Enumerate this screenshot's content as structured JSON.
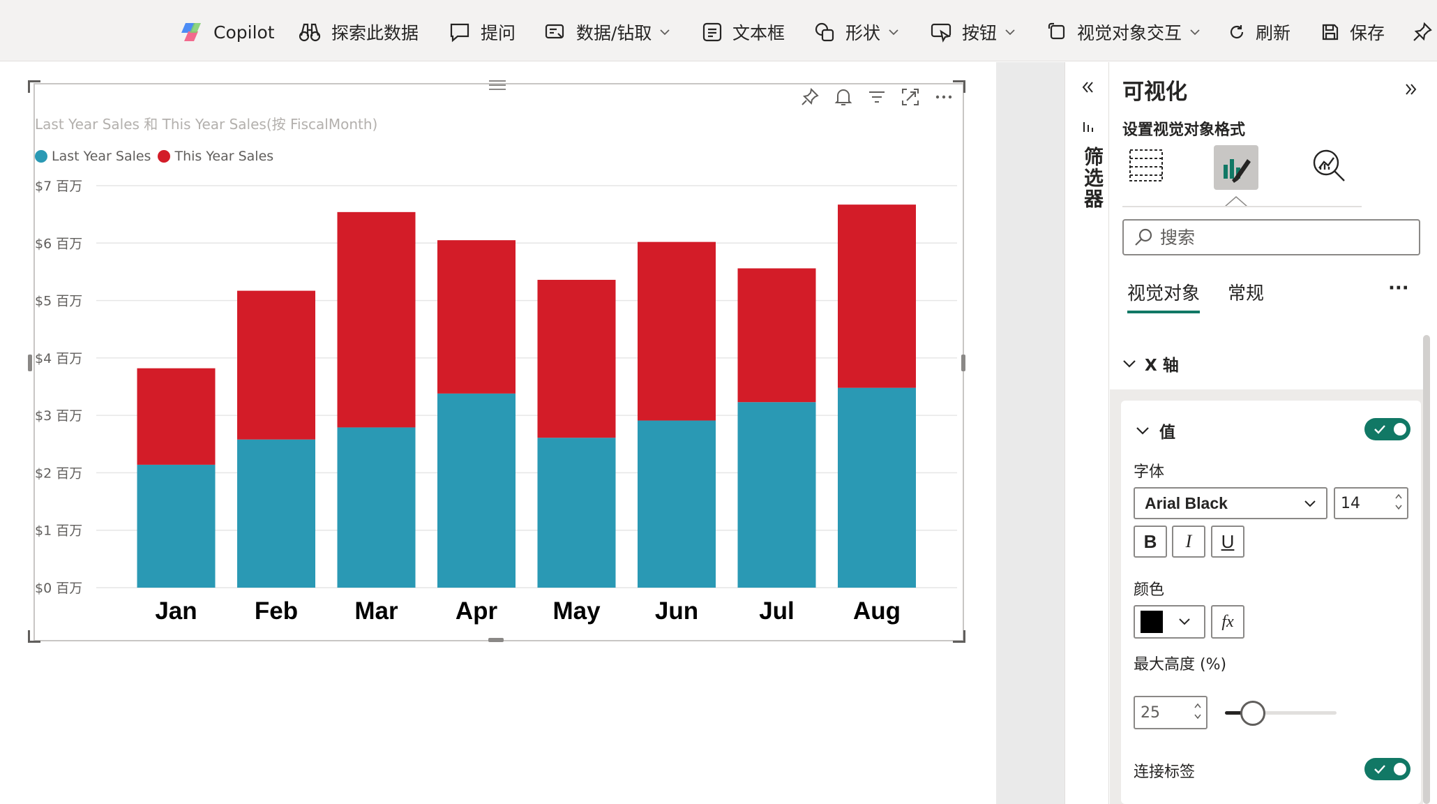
{
  "toolbar": {
    "copilot": "Copilot",
    "explore": "探索此数据",
    "ask": "提问",
    "data_drill": "数据/钻取",
    "textbox": "文本框",
    "shapes": "形状",
    "buttons": "按钮",
    "visual_interactions": "视觉对象交互",
    "refresh": "刷新",
    "save": "保存"
  },
  "visual": {
    "title": "Last Year Sales 和 This Year Sales(按 FiscalMonth)"
  },
  "chart_data": {
    "type": "bar",
    "stacked": true,
    "title": "Last Year Sales 和 This Year Sales(按 FiscalMonth)",
    "categories": [
      "Jan",
      "Feb",
      "Mar",
      "Apr",
      "May",
      "Jun",
      "Jul",
      "Aug"
    ],
    "series": [
      {
        "name": "Last Year Sales",
        "color": "#2a99b4",
        "values": [
          2.14,
          2.58,
          2.79,
          3.38,
          2.61,
          2.91,
          3.23,
          3.48
        ]
      },
      {
        "name": "This Year Sales",
        "color": "#d31c28",
        "values": [
          1.68,
          2.59,
          3.75,
          2.67,
          2.75,
          3.11,
          2.33,
          3.19
        ]
      }
    ],
    "y_ticks": [
      "$0 百万",
      "$1 百万",
      "$2 百万",
      "$3 百万",
      "$4 百万",
      "$5 百万",
      "$6 百万",
      "$7 百万"
    ],
    "ylim": [
      0,
      7
    ],
    "legend_position": "top-left",
    "grid": true
  },
  "filters": {
    "label": "筛选器"
  },
  "pane": {
    "title": "可视化",
    "subtitle": "设置视觉对象格式",
    "search_placeholder": "搜索",
    "tabs": [
      "视觉对象",
      "常规"
    ],
    "more": "···",
    "section": "X 轴",
    "card": {
      "header": "值",
      "font_label": "字体",
      "font_family": "Arial Black",
      "font_size": "14",
      "bold": "B",
      "italic": "I",
      "underline": "U",
      "color_label": "颜色",
      "color_value": "#000000",
      "fx": "fx",
      "max_height_label": "最大高度 (%)",
      "max_height_value": "25",
      "slider_fraction": 0.25,
      "concat_label": "连接标签"
    }
  }
}
